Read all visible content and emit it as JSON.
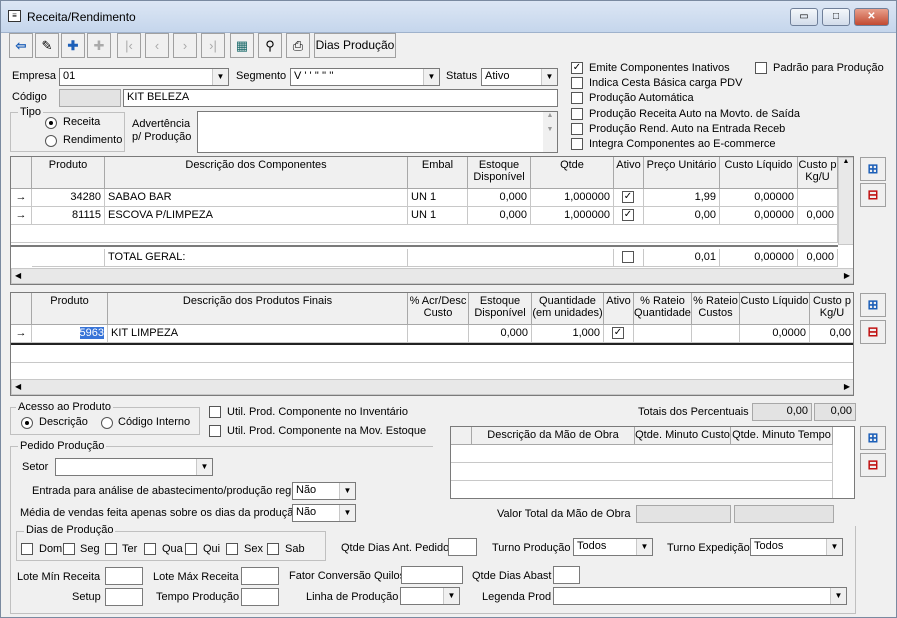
{
  "window": {
    "title": "Receita/Rendimento"
  },
  "toolbar": {
    "dias_producao": "Dias Produção"
  },
  "form": {
    "empresa_label": "Empresa",
    "empresa_value": "01",
    "segmento_label": "Segmento",
    "segmento_value": "V ' ' '' '' ''",
    "status_label": "Status",
    "status_value": "Ativo",
    "codigo_label": "Código",
    "codigo_value": "",
    "descricao_value": "KIT BELEZA",
    "tipo_label": "Tipo",
    "tipo_receita": "Receita",
    "tipo_rendimento": "Rendimento",
    "advertencia_label1": "Advertência",
    "advertencia_label2": "p/ Produção"
  },
  "checks": {
    "emite": "Emite Componentes Inativos",
    "padrao": "Padrão para Produção",
    "cesta": "Indica Cesta Básica carga PDV",
    "auto": "Produção Automática",
    "receita_auto": "Produção Receita Auto na Movto. de Saída",
    "rend_auto": "Produção Rend. Auto na Entrada Receb",
    "ecommerce": "Integra Componentes ao E-commerce"
  },
  "grid1": {
    "headers": [
      "Produto",
      "Descrição dos Componentes",
      "Embal",
      "Estoque Disponível",
      "Qtde",
      "Ativo",
      "Preço Unitário",
      "Custo Líquido",
      "Custo p Kg/U"
    ],
    "rows": [
      {
        "produto": "34280",
        "descricao": "SABAO BAR",
        "embal": "UN  1",
        "estoque": "0,000",
        "qtde": "1,000000",
        "preco": "1,99",
        "custo": "0,00000",
        "kg": ""
      },
      {
        "produto": "81115",
        "descricao": "ESCOVA P/LIMPEZA",
        "embal": "UN  1",
        "estoque": "0,000",
        "qtde": "1,000000",
        "preco": "0,00",
        "custo": "0,00000",
        "kg": "0,000"
      }
    ],
    "total_label": "TOTAL GERAL:",
    "total_preco": "0,01",
    "total_custo": "0,00000",
    "total_kg": "0,000"
  },
  "grid2": {
    "headers": [
      "Produto",
      "Descrição dos Produtos Finais",
      "% Acr/Desc Custo",
      "Estoque Disponível",
      "Quantidade (em unidades)",
      "Ativo",
      "% Rateio Quantidade",
      "% Rateio Custos",
      "Custo Líquido",
      "Custo p Kg/U"
    ],
    "row": {
      "produto": "5963",
      "descricao": "KIT LIMPEZA",
      "estoque": "0,000",
      "quantidade": "1,000",
      "custo": "0,0000",
      "kg": "0,00"
    }
  },
  "acesso": {
    "title": "Acesso ao Produto",
    "descricao": "Descrição",
    "codigo": "Código Interno"
  },
  "util": {
    "inventario": "Util. Prod. Componente no Inventário",
    "movestoque": "Util. Prod. Componente na Mov. Estoque"
  },
  "totais": {
    "label": "Totais dos Percentuais",
    "v1": "0,00",
    "v2": "0,00"
  },
  "mao": {
    "headers": [
      "Descrição da Mão de Obra",
      "Qtde. Minuto Custo",
      "Qtde. Minuto Tempo"
    ],
    "valor_label": "Valor Total da Mão de Obra"
  },
  "pedido": {
    "title": "Pedido Produção",
    "setor_label": "Setor",
    "entrada_label": "Entrada para análise de abastecimento/produção regular",
    "entrada_value": "Não",
    "media_label": "Média de vendas feita apenas sobre os dias da produção",
    "media_value": "Não"
  },
  "dias": {
    "title": "Dias de Produção",
    "days": [
      "Dom",
      "Seg",
      "Ter",
      "Qua",
      "Qui",
      "Sex",
      "Sab"
    ]
  },
  "bottom": {
    "qtde_dias_ant": "Qtde Dias Ant. Pedido",
    "turno_prod": "Turno Produção",
    "turno_prod_value": "Todos",
    "turno_exp": "Turno Expedição",
    "turno_exp_value": "Todos",
    "lote_min": "Lote Mín Receita",
    "lote_max": "Lote Máx Receita",
    "fator": "Fator Conversão Quilos",
    "qtde_abast": "Qtde Dias Abast",
    "setup": "Setup",
    "tempo": "Tempo Produção",
    "linha": "Linha de Produção",
    "legenda": "Legenda Prod"
  }
}
